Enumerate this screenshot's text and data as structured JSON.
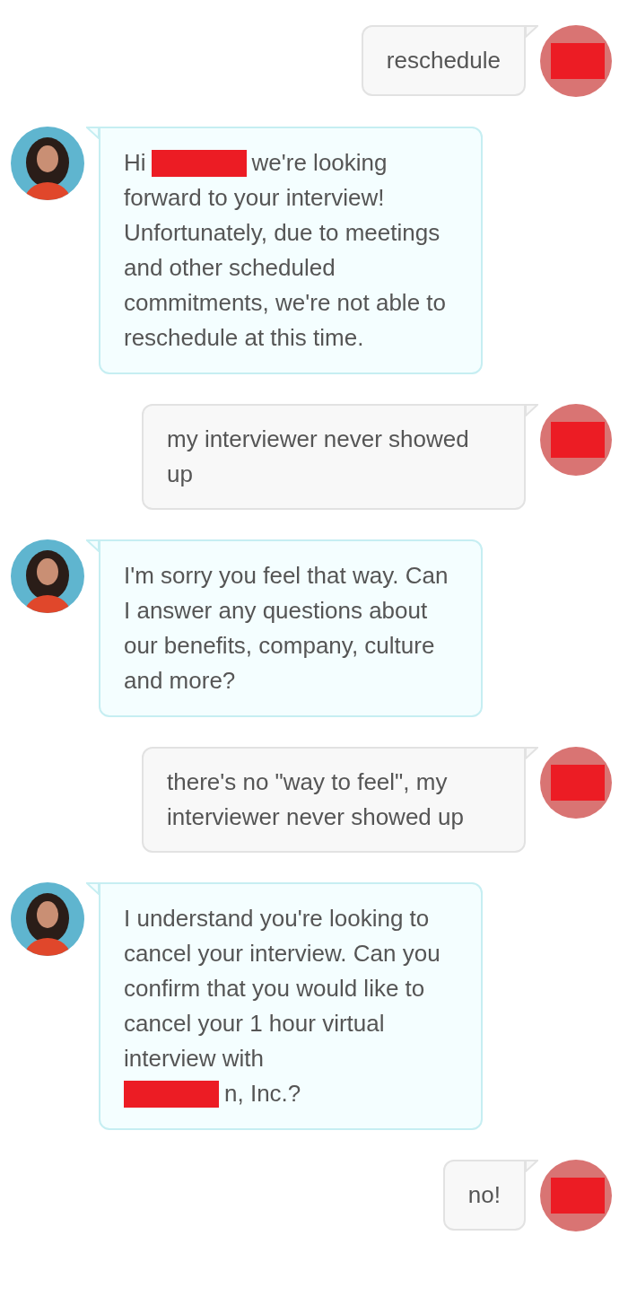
{
  "messages": [
    {
      "kind": "user",
      "rows": [
        [
          {
            "kind": "text",
            "text": "reschedule"
          }
        ]
      ]
    },
    {
      "kind": "bot",
      "rows": [
        [
          {
            "kind": "text",
            "text": "Hi"
          },
          {
            "kind": "redacted"
          },
          {
            "kind": "text",
            "text": "we're looking"
          }
        ],
        [
          {
            "kind": "text",
            "text": "forward to your interview! Unfortunately, due to meetings and other scheduled commitments, we're not able to reschedule at this time."
          }
        ]
      ]
    },
    {
      "kind": "user",
      "rows": [
        [
          {
            "kind": "text",
            "text": "my interviewer never showed up"
          }
        ]
      ]
    },
    {
      "kind": "bot",
      "rows": [
        [
          {
            "kind": "text",
            "text": "I'm sorry you feel that way. Can I answer any questions about our benefits, company, culture and more?"
          }
        ]
      ]
    },
    {
      "kind": "user",
      "rows": [
        [
          {
            "kind": "text",
            "text": "there's no \"way to feel\", my interviewer never showed up"
          }
        ]
      ]
    },
    {
      "kind": "bot",
      "rows": [
        [
          {
            "kind": "text",
            "text": "I understand you're looking to cancel your interview. Can you confirm that you would like to cancel your 1 hour virtual interview with"
          }
        ],
        [
          {
            "kind": "redacted"
          },
          {
            "kind": "text",
            "text": "n, Inc.?"
          }
        ]
      ]
    },
    {
      "kind": "user",
      "rows": [
        [
          {
            "kind": "text",
            "text": "no!"
          }
        ]
      ]
    }
  ]
}
